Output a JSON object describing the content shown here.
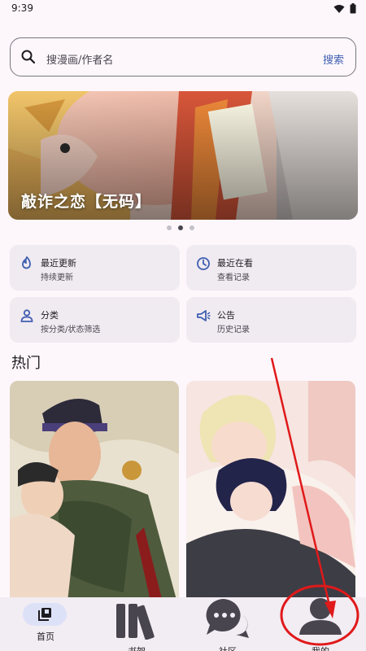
{
  "status_bar": {
    "time": "9:39"
  },
  "search": {
    "placeholder": "搜漫画/作者名",
    "button_label": "搜索"
  },
  "banner": {
    "title": "敲诈之恋【无码】",
    "active_dot": 1,
    "dot_count": 3
  },
  "quick_links": [
    {
      "title": "最近更新",
      "subtitle": "持续更新",
      "icon": "flame-icon"
    },
    {
      "title": "最近在看",
      "subtitle": "查看记录",
      "icon": "clock-icon"
    },
    {
      "title": "分类",
      "subtitle": "按分类/状态筛选",
      "icon": "person-icon"
    },
    {
      "title": "公告",
      "subtitle": "历史记录",
      "icon": "megaphone-icon"
    }
  ],
  "hot": {
    "title": "热门"
  },
  "bottom_nav": {
    "items": [
      {
        "label": "首页",
        "icon": "library-icon",
        "active": true
      },
      {
        "label": "书架",
        "icon": "bookshelf-icon",
        "active": false
      },
      {
        "label": "社区",
        "icon": "chat-bubbles-icon",
        "active": false
      },
      {
        "label": "我的",
        "icon": "user-icon",
        "active": false
      }
    ]
  },
  "colors": {
    "accent": "#3f5fb0",
    "background": "#fdf7fc",
    "card": "#f0eaf1",
    "annotation": "#e0191a"
  }
}
